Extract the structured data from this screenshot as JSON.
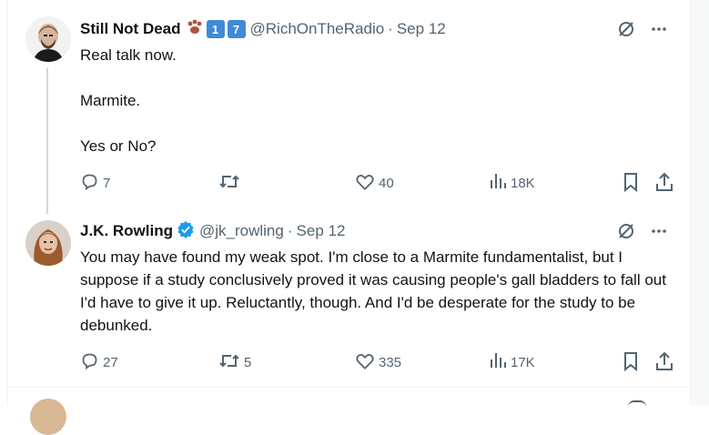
{
  "tweets": [
    {
      "name": "Still Not Dead",
      "badges": [
        "paw-emoji",
        "1",
        "7"
      ],
      "handle": "@RichOnTheRadio",
      "time": "Sep 12",
      "text": "Real talk now.\n\nMarmite.\n\nYes or No?",
      "replies": "7",
      "retweets": "",
      "likes": "40",
      "views": "18K"
    },
    {
      "name": "J.K. Rowling",
      "verified": true,
      "handle": "@jk_rowling",
      "time": "Sep 12",
      "text": "You may have found my weak spot. I'm close to a Marmite fundamentalist, but I suppose if a study conclusively proved it was causing people's gall bladders to fall out I'd have to give it up. Reluctantly, though. And I'd be desperate for the study to be debunked.",
      "replies": "27",
      "retweets": "5",
      "likes": "335",
      "views": "17K"
    }
  ],
  "colors": {
    "text": "#0f1419",
    "secondary": "#536471",
    "verified": "#1d9bf0",
    "badge_blue": "#3f8ad8",
    "thread_line": "#cfd9de"
  }
}
